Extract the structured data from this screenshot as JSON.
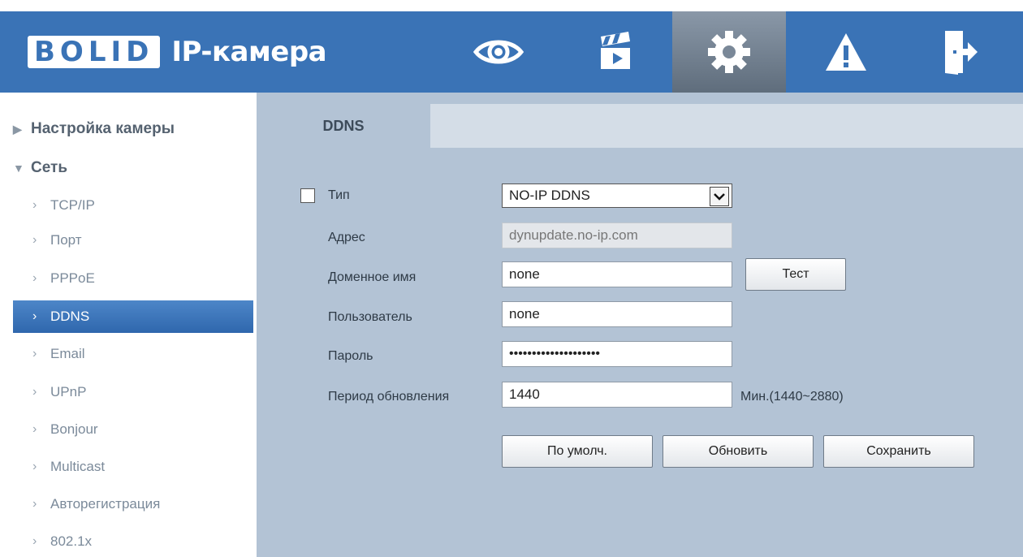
{
  "header": {
    "logo_brand": "BOLID",
    "logo_product": "IP-камера",
    "nav": [
      {
        "name": "live-view",
        "icon": "eye-icon"
      },
      {
        "name": "playback",
        "icon": "clapperboard-icon"
      },
      {
        "name": "setup",
        "icon": "gear-icon",
        "active": true
      },
      {
        "name": "alarm",
        "icon": "warning-icon"
      },
      {
        "name": "logout",
        "icon": "exit-door-icon"
      }
    ]
  },
  "sidebar": {
    "groups": [
      {
        "label": "Настройка камеры",
        "expanded": false
      },
      {
        "label": "Сеть",
        "expanded": true
      }
    ],
    "items": [
      "TCP/IP",
      "Порт",
      "PPPoE",
      "DDNS",
      "Email",
      "UPnP",
      "Bonjour",
      "Multicast",
      "Авторегистрация",
      "802.1x"
    ],
    "selected": "DDNS"
  },
  "tab": {
    "label": "DDNS"
  },
  "form": {
    "type_label": "Тип",
    "type_checked": false,
    "type_value": "NO-IP DDNS",
    "address_label": "Адрес",
    "address_value": "dynupdate.no-ip.com",
    "domain_label": "Доменное имя",
    "domain_value": "none",
    "test_button": "Тест",
    "user_label": "Пользователь",
    "user_value": "none",
    "password_label": "Пароль",
    "password_value": "••••••••••••••••••••",
    "period_label": "Период обновления",
    "period_value": "1440",
    "period_hint": "Мин.(1440~2880)"
  },
  "buttons": {
    "default": "По умолч.",
    "refresh": "Обновить",
    "save": "Сохранить"
  },
  "colors": {
    "header_bg": "#3a73b6",
    "content_bg": "#b3c3d5",
    "selected_item": "#3a73b6"
  }
}
